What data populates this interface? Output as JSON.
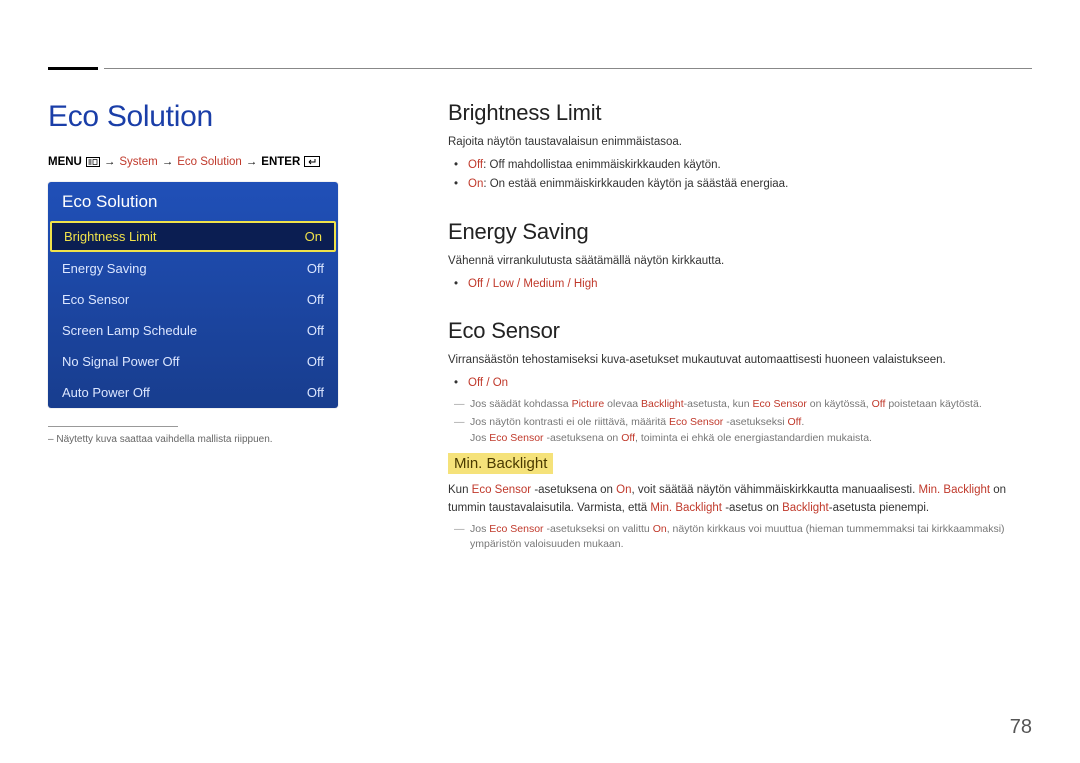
{
  "page_number": "78",
  "page_title": "Eco Solution",
  "breadcrumb": {
    "menu_label": "MENU",
    "path_system": "System",
    "path_eco": "Eco Solution",
    "enter_label": "ENTER"
  },
  "menu_card": {
    "header": "Eco Solution",
    "items": [
      {
        "label": "Brightness Limit",
        "value": "On",
        "selected": true
      },
      {
        "label": "Energy Saving",
        "value": "Off",
        "selected": false
      },
      {
        "label": "Eco Sensor",
        "value": "Off",
        "selected": false
      },
      {
        "label": "Screen Lamp Schedule",
        "value": "Off",
        "selected": false
      },
      {
        "label": "No Signal Power Off",
        "value": "Off",
        "selected": false
      },
      {
        "label": "Auto Power Off",
        "value": "Off",
        "selected": false
      }
    ]
  },
  "left_footnote": "Näytetty kuva saattaa vaihdella mallista riippuen.",
  "sections": {
    "brightness_limit": {
      "title": "Brightness Limit",
      "intro": "Rajoita näytön taustavalaisun enimmäistasoa.",
      "bullet_off_kw": "Off",
      "bullet_off_text": ": Off mahdollistaa enimmäiskirkkauden käytön.",
      "bullet_on_kw": "On",
      "bullet_on_text": ": On estää enimmäiskirkkauden käytön ja säästää energiaa."
    },
    "energy_saving": {
      "title": "Energy Saving",
      "intro": "Vähennä virrankulutusta säätämällä näytön kirkkautta.",
      "options": "Off / Low / Medium / High"
    },
    "eco_sensor": {
      "title": "Eco Sensor",
      "intro": "Virransäästön tehostamiseksi kuva-asetukset mukautuvat automaattisesti huoneen valaistukseen.",
      "options": "Off / On",
      "note1_a": "Jos säädät kohdassa ",
      "note1_picture": "Picture",
      "note1_b": " olevaa ",
      "note1_backlight": "Backlight",
      "note1_c": "-asetusta, kun ",
      "note1_eco": "Eco Sensor",
      "note1_d": " on käytössä, ",
      "note1_off": "Off",
      "note1_e": " poistetaan käytöstä.",
      "note2_a": "Jos näytön kontrasti ei ole riittävä, määritä ",
      "note2_eco": "Eco Sensor",
      "note2_b": " -asetukseksi ",
      "note2_off": "Off",
      "note2_c": ".",
      "note2_line2_a": "Jos ",
      "note2_line2_eco": "Eco Sensor",
      "note2_line2_b": " -asetuksena on ",
      "note2_line2_off": "Off",
      "note2_line2_c": ", toiminta ei ehkä ole energiastandardien mukaista."
    },
    "min_backlight": {
      "title": "Min. Backlight",
      "p_a": "Kun ",
      "p_eco": "Eco Sensor",
      "p_b": " -asetuksena on ",
      "p_on": "On",
      "p_c": ", voit säätää näytön vähimmäiskirkkautta manuaalisesti. ",
      "p_mb": "Min. Backlight",
      "p_d": " on tummin taustavalaisutila. Varmista, että ",
      "p_mb2": "Min. Backlight",
      "p_e": " -asetus on ",
      "p_bl": "Backlight",
      "p_f": "-asetusta pienempi.",
      "note_a": "Jos ",
      "note_eco": "Eco Sensor",
      "note_b": " -asetukseksi on valittu ",
      "note_on": "On",
      "note_c": ", näytön kirkkaus voi muuttua (hieman tummemmaksi tai kirkkaammaksi) ympäristön valoisuuden mukaan."
    }
  }
}
